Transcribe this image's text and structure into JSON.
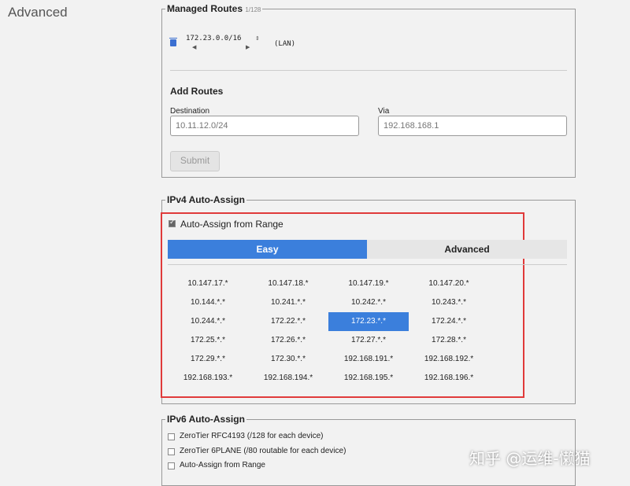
{
  "sidebar": {
    "title": "Advanced"
  },
  "managed_routes": {
    "legend": "Managed Routes",
    "count": "1/128",
    "routes": [
      {
        "destination": "172.23.0.0/16",
        "via": "(LAN)"
      }
    ]
  },
  "add_routes": {
    "title": "Add Routes",
    "destination_label": "Destination",
    "destination_placeholder": "10.11.12.0/24",
    "via_label": "Via",
    "via_placeholder": "192.168.168.1",
    "submit_label": "Submit"
  },
  "ipv4": {
    "legend": "IPv4 Auto-Assign",
    "auto_assign_label": "Auto-Assign from Range",
    "auto_assign_checked": true,
    "tabs": {
      "easy": "Easy",
      "advanced": "Advanced"
    },
    "ranges": [
      [
        "10.147.17.*",
        "10.147.18.*",
        "10.147.19.*",
        "10.147.20.*"
      ],
      [
        "10.144.*.*",
        "10.241.*.*",
        "10.242.*.*",
        "10.243.*.*"
      ],
      [
        "10.244.*.*",
        "172.22.*.*",
        "172.23.*.*",
        "172.24.*.*"
      ],
      [
        "172.25.*.*",
        "172.26.*.*",
        "172.27.*.*",
        "172.28.*.*"
      ],
      [
        "172.29.*.*",
        "172.30.*.*",
        "192.168.191.*",
        "192.168.192.*"
      ],
      [
        "192.168.193.*",
        "192.168.194.*",
        "192.168.195.*",
        "192.168.196.*"
      ]
    ],
    "selected_range": "172.23.*.*"
  },
  "ipv6": {
    "legend": "IPv6 Auto-Assign",
    "options": [
      "ZeroTier RFC4193 (/128 for each device)",
      "ZeroTier 6PLANE (/80 routable for each device)",
      "Auto-Assign from Range"
    ]
  },
  "watermark": {
    "text": "知乎 @运维-懒猫"
  },
  "colors": {
    "accent": "#3b7fdc",
    "highlight_border": "#e03a3a"
  }
}
